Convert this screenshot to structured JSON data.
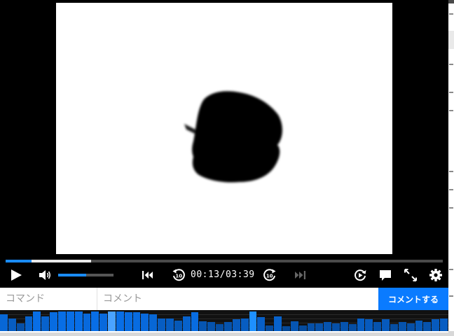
{
  "player": {
    "time_current": "00:13",
    "time_separator": "/",
    "time_total": "03:39",
    "progress_fraction": 0.0593,
    "buffered_fraction": 0.196,
    "volume_fraction": 0.5,
    "accent_color": "#1a8cff"
  },
  "controls": {
    "play_icon": "play-icon",
    "volume_icon": "speaker-icon",
    "prev_icon": "skip-to-start-icon",
    "rewind_icon": "rewind-10-icon",
    "forward_icon": "forward-10-icon",
    "next_icon": "skip-next-icon",
    "loop_icon": "repeat-play-icon",
    "comments_icon": "comment-toggle-icon",
    "fullscreen_icon": "fullscreen-icon",
    "settings_icon": "gear-icon"
  },
  "comment_bar": {
    "command_placeholder": "コマンド",
    "comment_placeholder": "コメント",
    "submit_label": "コメントする",
    "submit_color": "#0a7bff"
  },
  "comment_graph": {
    "levels": [
      0.85,
      0.65,
      0.4,
      0.75,
      1.0,
      0.75,
      0.95,
      1.0,
      1.0,
      1.0,
      0.9,
      1.0,
      0.9,
      1.0,
      1.0,
      0.95,
      0.95,
      0.9,
      0.85,
      0.65,
      0.65,
      0.55,
      0.75,
      0.95,
      0.5,
      0.45,
      0.35,
      0.45,
      0.6,
      0.65,
      1.0,
      0.7,
      0.3,
      0.75,
      0.25,
      0.5,
      0.3,
      0.4,
      0.4,
      0.45,
      0.4,
      0.45,
      0.35,
      0.65,
      0.6,
      0.45,
      0.6,
      0.35,
      0.45,
      0.4,
      0.55,
      0.45,
      0.6,
      0.65
    ],
    "bright_indices": [
      30
    ],
    "pale_indices": [
      13
    ]
  }
}
